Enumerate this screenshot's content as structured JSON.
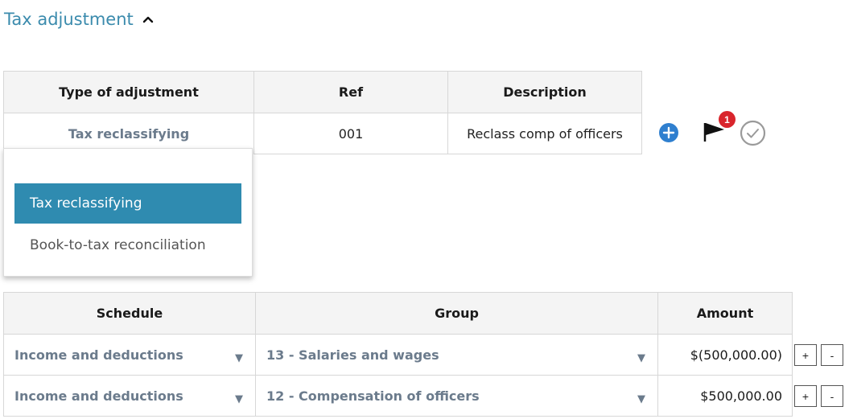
{
  "section": {
    "title": "Tax adjustment",
    "collapse_icon": "chevron-up-icon"
  },
  "adjustment_table": {
    "headers": {
      "type": "Type of adjustment",
      "ref": "Ref",
      "description": "Description"
    },
    "row": {
      "type": "Tax reclassifying",
      "ref": "001",
      "description": "Reclass comp of officers"
    }
  },
  "row_actions": {
    "add_icon": "plus-circle-icon",
    "flag_icon": "flag-icon",
    "flag_count": "1",
    "check_icon": "check-circle-icon"
  },
  "dropdown": {
    "options": [
      {
        "label": "Tax reclassifying",
        "selected": true
      },
      {
        "label": "Book-to-tax reconciliation",
        "selected": false
      }
    ]
  },
  "schedule_table": {
    "headers": {
      "schedule": "Schedule",
      "group": "Group",
      "amount": "Amount"
    },
    "rows": [
      {
        "schedule": "Income and deductions",
        "group": "13 - Salaries and wages",
        "amount": "$(500,000.00)",
        "plus": "+",
        "minus": "-"
      },
      {
        "schedule": "Income and deductions",
        "group": "12 - Compensation of officers",
        "amount": "$500,000.00",
        "plus": "+",
        "minus": "-"
      }
    ]
  },
  "colors": {
    "accent": "#2f8bb0",
    "title": "#3b8bad",
    "badge": "#d9252c",
    "muted_text": "#6b7b8c"
  }
}
